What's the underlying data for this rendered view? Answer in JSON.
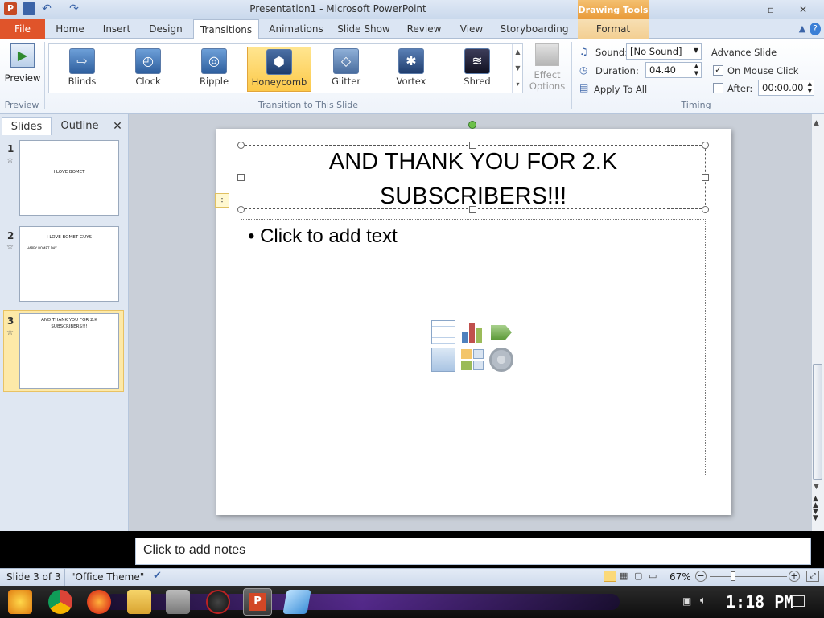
{
  "window": {
    "title": "Presentation1 - Microsoft PowerPoint",
    "contextual_tab_group": "Drawing Tools",
    "minimize": "–",
    "restore": "▫",
    "close": "✕"
  },
  "tabs": [
    "File",
    "Home",
    "Insert",
    "Design",
    "Transitions",
    "Animations",
    "Slide Show",
    "Review",
    "View",
    "Storyboarding",
    "Format"
  ],
  "active_tab": "Transitions",
  "ribbon": {
    "preview": {
      "label": "Preview",
      "group_label": "Preview"
    },
    "transitions": {
      "items": [
        "Blinds",
        "Clock",
        "Ripple",
        "Honeycomb",
        "Glitter",
        "Vortex",
        "Shred"
      ],
      "selected": "Honeycomb",
      "effect_options_line1": "Effect",
      "effect_options_line2": "Options",
      "group_label": "Transition to This Slide"
    },
    "timing": {
      "sound_label": "Sound:",
      "sound_value": "[No Sound]",
      "duration_label": "Duration:",
      "duration_value": "04.40",
      "apply_all": "Apply To All",
      "advance_slide": "Advance Slide",
      "on_mouse_click": "On Mouse Click",
      "on_mouse_click_checked": true,
      "after_label": "After:",
      "after_value": "00:00.00",
      "after_checked": false,
      "group_label": "Timing"
    }
  },
  "left_panel": {
    "tab_slides": "Slides",
    "tab_outline": "Outline",
    "close": "✕",
    "slides": [
      {
        "number": "1",
        "text": "I LOVE BOMET",
        "bullet": ""
      },
      {
        "number": "2",
        "text": "I LOVE BOMET GUYS",
        "bullet": "HAPPY BOMET DAY"
      },
      {
        "number": "3",
        "text": "AND THANK YOU FOR 2.K SUBSCRIBERS!!!",
        "bullet": ""
      }
    ],
    "selected_slide": 3
  },
  "slide": {
    "title": "AND THANK YOU FOR 2.K SUBSCRIBERS!!!",
    "content_placeholder": "Click to add text"
  },
  "notes": {
    "placeholder": "Click to add notes"
  },
  "status": {
    "slide_info": "Slide 3 of 3",
    "theme": "\"Office Theme\"",
    "zoom": "67%"
  },
  "taskbar": {
    "clock": "1:18 PM"
  },
  "colors": {
    "file_tab": "#e0542a",
    "selected_gallery": "#fcc94a",
    "drawing_tools": "#e99a38",
    "selected_thumb": "#fde9a8"
  }
}
